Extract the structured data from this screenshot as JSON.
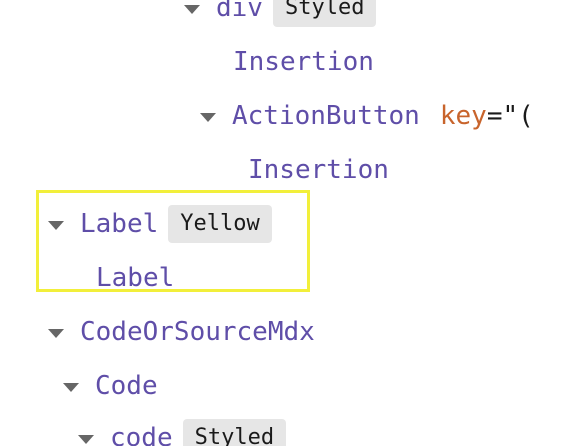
{
  "tree": {
    "row_div": {
      "name": "div",
      "badge": "Styled"
    },
    "row_insertion_1": {
      "text": "Insertion"
    },
    "row_action_button": {
      "name": "ActionButton",
      "prop_key": "key",
      "prop_eq": "=",
      "prop_value": "\"("
    },
    "row_insertion_2": {
      "text": "Insertion"
    },
    "row_label": {
      "name": "Label",
      "badge": "Yellow"
    },
    "row_label_child": {
      "text": "Label"
    },
    "row_code_or_source": {
      "name": "CodeOrSourceMdx"
    },
    "row_code": {
      "name": "Code"
    },
    "row_code_lower": {
      "name": "code",
      "badge": "Styled"
    }
  },
  "colors": {
    "component_name": "#5f4ea8",
    "prop_key": "#c8642c",
    "badge_bg": "#e6e6e6",
    "highlight_border": "#f2ef3a",
    "caret": "#666666"
  }
}
